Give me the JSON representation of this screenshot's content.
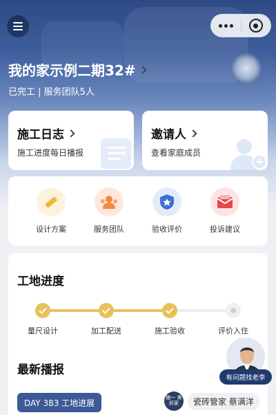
{
  "header": {
    "project_title": "我的家示例二期32#",
    "project_status": "已完工 | 服务团队5人"
  },
  "cards": {
    "log": {
      "title": "施工日志",
      "subtitle": "施工进度每日播报"
    },
    "invite": {
      "title": "邀请人",
      "subtitle": "查看家庭成员"
    }
  },
  "quick_actions": [
    {
      "label": "设计方案",
      "icon": "design-ruler-icon",
      "color": "#f5b936"
    },
    {
      "label": "服务团队",
      "icon": "team-icon",
      "color": "#f08a3c"
    },
    {
      "label": "验收评价",
      "icon": "shield-star-icon",
      "color": "#3f6fd8"
    },
    {
      "label": "投诉建议",
      "icon": "mail-icon",
      "color": "#e4494b"
    }
  ],
  "progress": {
    "title": "工地进度",
    "steps": [
      {
        "label": "量尺设计",
        "done": true
      },
      {
        "label": "加工配送",
        "done": true
      },
      {
        "label": "施工验收",
        "done": true
      },
      {
        "label": "评价入住",
        "done": false
      }
    ],
    "accent_color": "#e8c15a"
  },
  "news": {
    "title": "最新播报",
    "tag": "DAY 383 工地进展",
    "manager_logo": "随一 美好家",
    "manager": "瓷砖管家 蔡满洋"
  },
  "advisor": {
    "button": "有问题找老李"
  }
}
